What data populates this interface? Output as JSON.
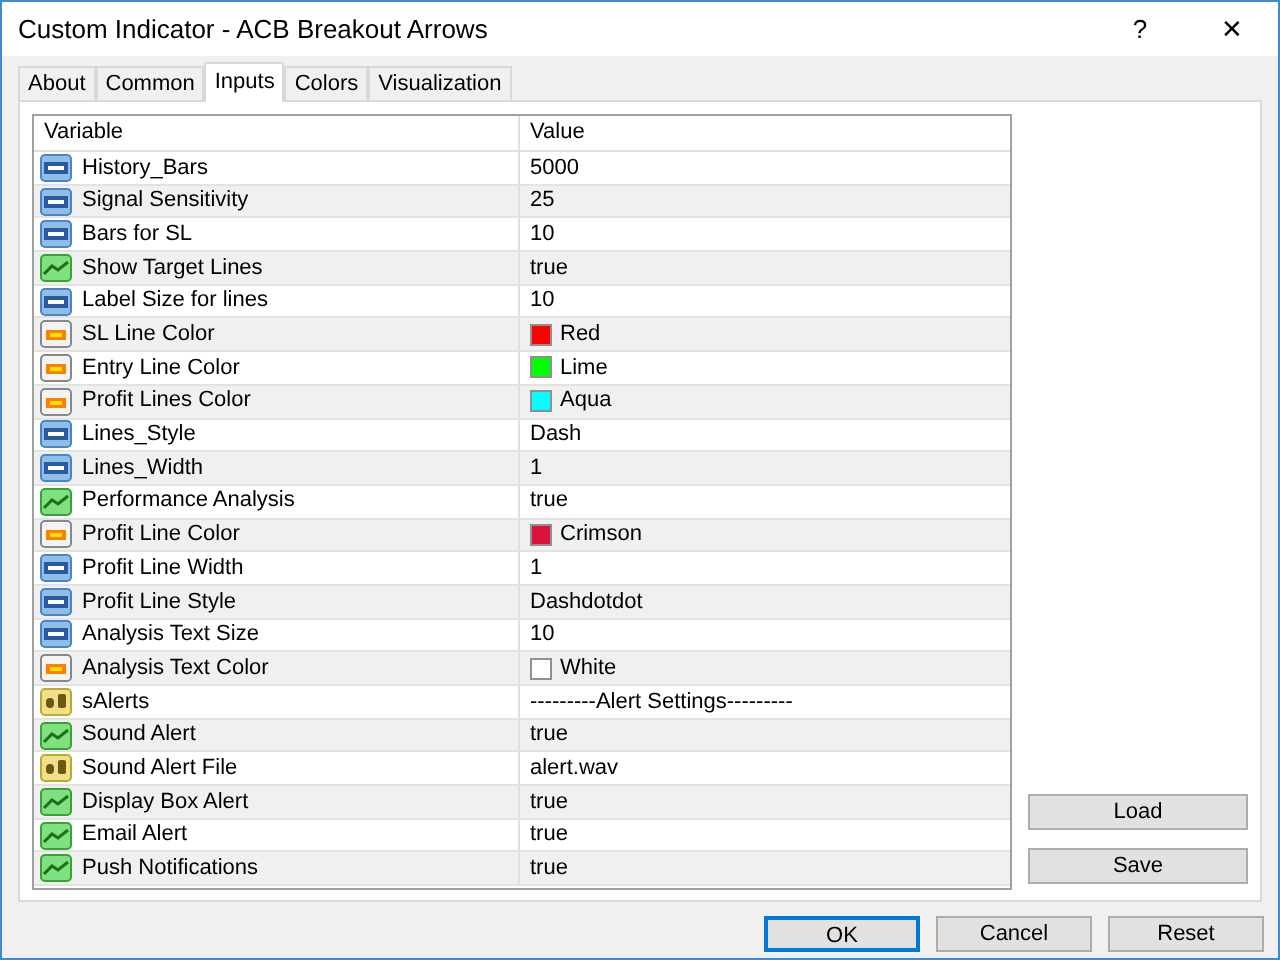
{
  "window": {
    "title": "Custom Indicator - ACB Breakout Arrows",
    "help": "?",
    "close": "✕"
  },
  "tabs": [
    {
      "label": "About",
      "selected": false
    },
    {
      "label": "Common",
      "selected": false
    },
    {
      "label": "Inputs",
      "selected": true
    },
    {
      "label": "Colors",
      "selected": false
    },
    {
      "label": "Visualization",
      "selected": false
    }
  ],
  "table": {
    "columns": [
      "Variable",
      "Value"
    ],
    "rows": [
      {
        "kind": "int",
        "variable": "History_Bars",
        "value": "5000"
      },
      {
        "kind": "int",
        "variable": "Signal Sensitivity",
        "value": "25"
      },
      {
        "kind": "int",
        "variable": "Bars for SL",
        "value": "10"
      },
      {
        "kind": "bool",
        "variable": "Show Target Lines",
        "value": "true"
      },
      {
        "kind": "int",
        "variable": "Label Size for lines",
        "value": "10"
      },
      {
        "kind": "color",
        "variable": "SL Line Color",
        "value": "Red",
        "color": "#ff0000"
      },
      {
        "kind": "color",
        "variable": "Entry Line Color",
        "value": "Lime",
        "color": "#00ff00"
      },
      {
        "kind": "color",
        "variable": "Profit Lines Color",
        "value": "Aqua",
        "color": "#00ffff"
      },
      {
        "kind": "int",
        "variable": "Lines_Style",
        "value": "Dash"
      },
      {
        "kind": "int",
        "variable": "Lines_Width",
        "value": "1"
      },
      {
        "kind": "bool",
        "variable": "Performance Analysis",
        "value": "true"
      },
      {
        "kind": "color",
        "variable": "Profit Line Color",
        "value": "Crimson",
        "color": "#dc143c"
      },
      {
        "kind": "int",
        "variable": "Profit Line Width",
        "value": "1"
      },
      {
        "kind": "int",
        "variable": "Profit Line Style",
        "value": "Dashdotdot"
      },
      {
        "kind": "int",
        "variable": "Analysis Text Size",
        "value": "10"
      },
      {
        "kind": "color",
        "variable": "Analysis Text Color",
        "value": "White",
        "color": "#ffffff"
      },
      {
        "kind": "string",
        "variable": "sAlerts",
        "value": "---------Alert Settings---------"
      },
      {
        "kind": "bool",
        "variable": "Sound Alert",
        "value": "true"
      },
      {
        "kind": "string",
        "variable": "Sound Alert File",
        "value": "alert.wav"
      },
      {
        "kind": "bool",
        "variable": "Display Box Alert",
        "value": "true"
      },
      {
        "kind": "bool",
        "variable": "Email Alert",
        "value": "true"
      },
      {
        "kind": "bool",
        "variable": "Push Notifications",
        "value": "true"
      }
    ]
  },
  "side_buttons": [
    "Load",
    "Save"
  ],
  "buttons": [
    {
      "label": "OK",
      "default": true
    },
    {
      "label": "Cancel",
      "default": false
    },
    {
      "label": "Reset",
      "default": false
    }
  ]
}
